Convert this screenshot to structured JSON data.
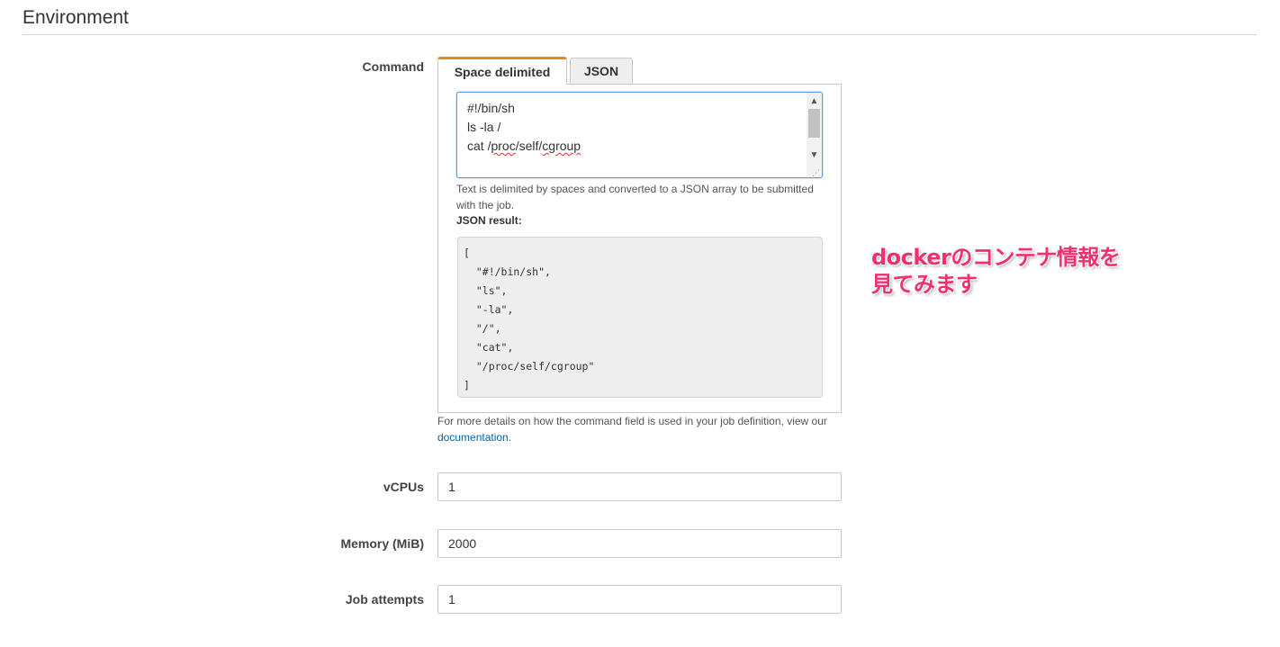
{
  "section": {
    "title": "Environment"
  },
  "command": {
    "label": "Command",
    "tabs": [
      {
        "label": "Space delimited",
        "active": true
      },
      {
        "label": "JSON",
        "active": false
      }
    ],
    "lines": [
      "#!/bin/sh",
      "ls -la /",
      "cat /",
      "proc",
      "/self/",
      "cgroup"
    ],
    "help_text": "Text is delimited by spaces and converted to a JSON array to be submitted with the job.",
    "json_result_label": "JSON result:",
    "json_result_lines": [
      "[",
      "  \"#!/bin/sh\",",
      "  \"ls\",",
      "  \"-la\",",
      "  \"/\",",
      "  \"cat\",",
      "  \"/proc/self/cgroup\"",
      "]"
    ],
    "doc_text_prefix": "For more details on how the command field is used in your job definition, view our ",
    "doc_link_text": "documentation",
    "doc_text_suffix": "."
  },
  "vcpus": {
    "label": "vCPUs",
    "value": "1"
  },
  "memory": {
    "label": "Memory (MiB)",
    "value": "2000"
  },
  "job_attempts": {
    "label": "Job attempts",
    "value": "1"
  },
  "annotation": {
    "line1": "dockerのコンテナ情報を",
    "line2": "見てみます"
  },
  "icons": {
    "scroll_up": "scroll-up-arrow-icon",
    "scroll_down": "scroll-down-arrow-icon",
    "resize": "resize-grip-icon"
  },
  "colors": {
    "active_tab_accent": "#e7871b",
    "link": "#0a61a7",
    "annotation": "#f0306f",
    "focus_border": "#5b9dd9"
  }
}
